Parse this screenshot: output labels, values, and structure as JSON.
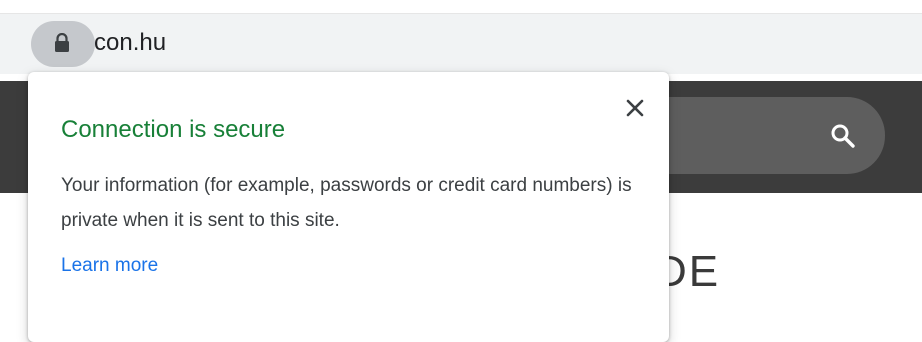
{
  "omnibox": {
    "url": "con.hu",
    "lock_icon": "lock-icon"
  },
  "page": {
    "heading_fragment": "DE",
    "search_icon": "search-icon",
    "header_color": "#3c3c3c"
  },
  "site_info_popup": {
    "title": "Connection is secure",
    "body": "Your information (for example, passwords or credit card numbers) is private when it is sent to this site.",
    "learn_more": "Learn more",
    "close_icon": "close-icon",
    "title_color": "#188038",
    "link_color": "#1a73e8"
  }
}
